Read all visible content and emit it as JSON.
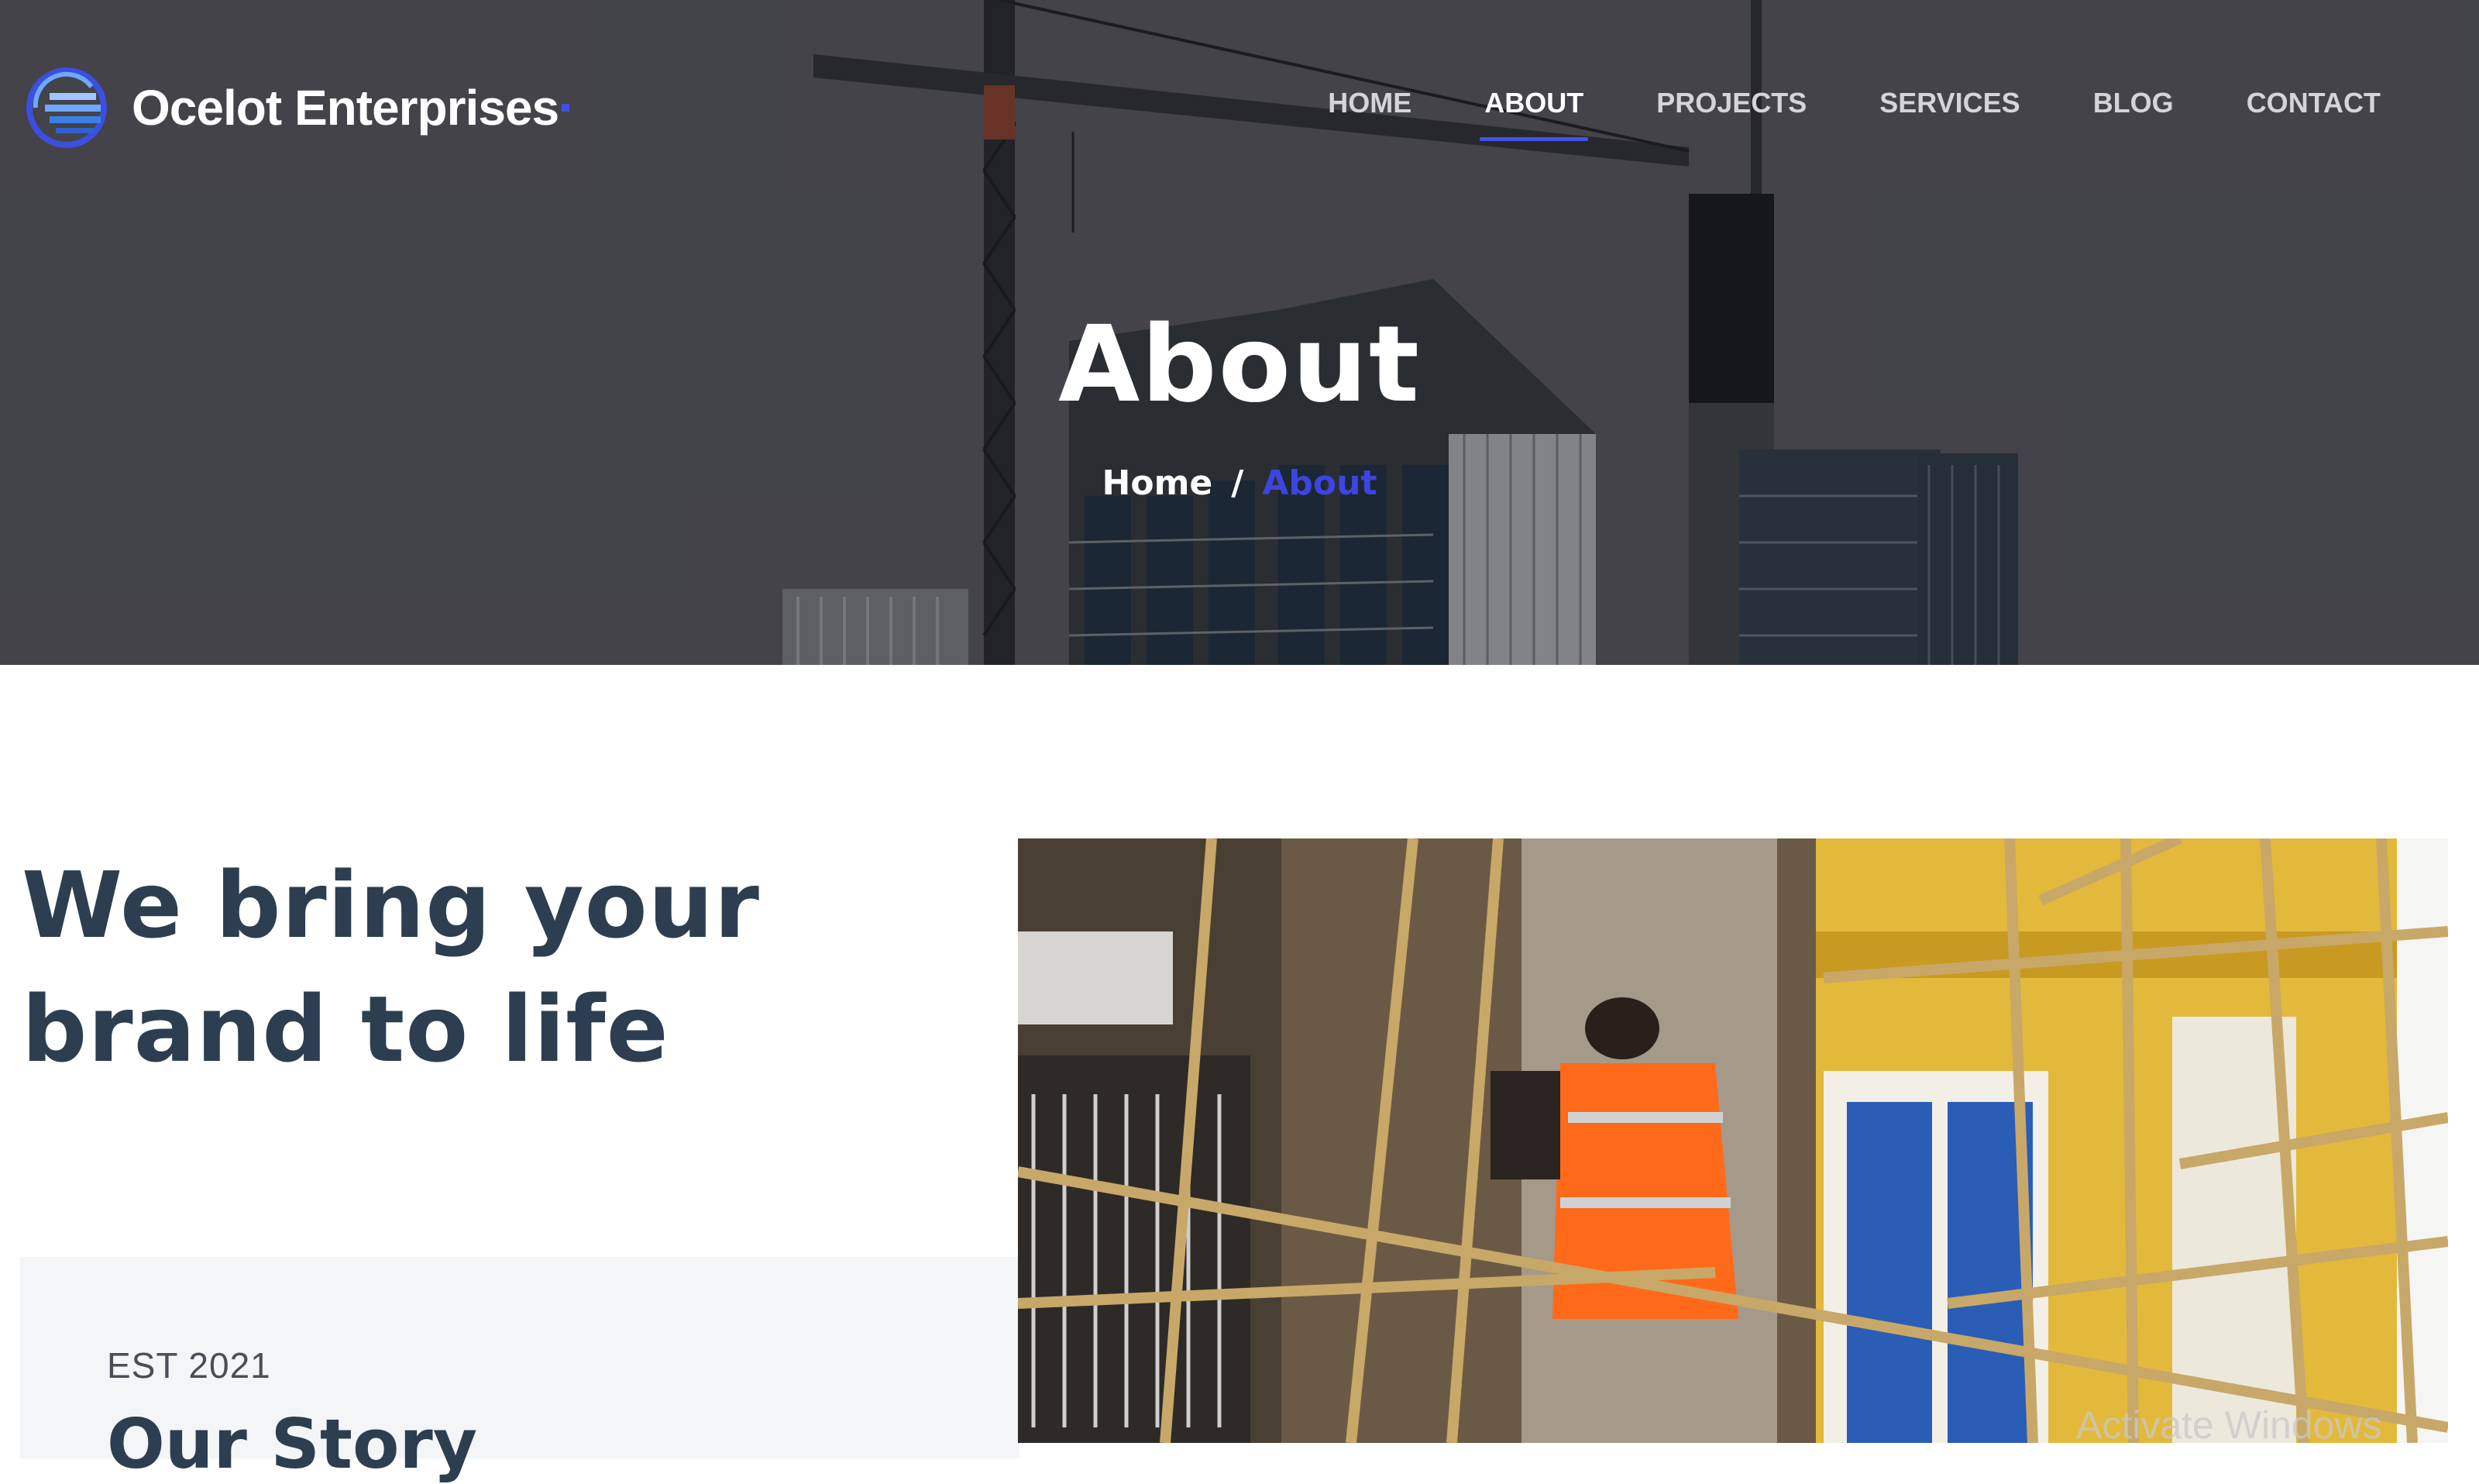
{
  "brand": {
    "name": "Ocelot Enterprises",
    "accent": "#3f51e0"
  },
  "nav": {
    "items": [
      {
        "label": "HOME"
      },
      {
        "label": "ABOUT"
      },
      {
        "label": "PROJECTS"
      },
      {
        "label": "SERVICES"
      },
      {
        "label": "BLOG"
      },
      {
        "label": "CONTACT"
      }
    ],
    "active": "ABOUT"
  },
  "hero": {
    "title": "About",
    "breadcrumb": {
      "home": "Home",
      "separator": "/",
      "current": "About"
    }
  },
  "intro": {
    "headline_line1": "We bring your",
    "headline_line2": "brand to life"
  },
  "story": {
    "est": "EST 2021",
    "title": "Our Story"
  },
  "system": {
    "watermark": "Activate Windows"
  },
  "colors": {
    "heading": "#2c3e50",
    "accent": "#3d45e0",
    "card_bg": "#f4f5f7"
  }
}
